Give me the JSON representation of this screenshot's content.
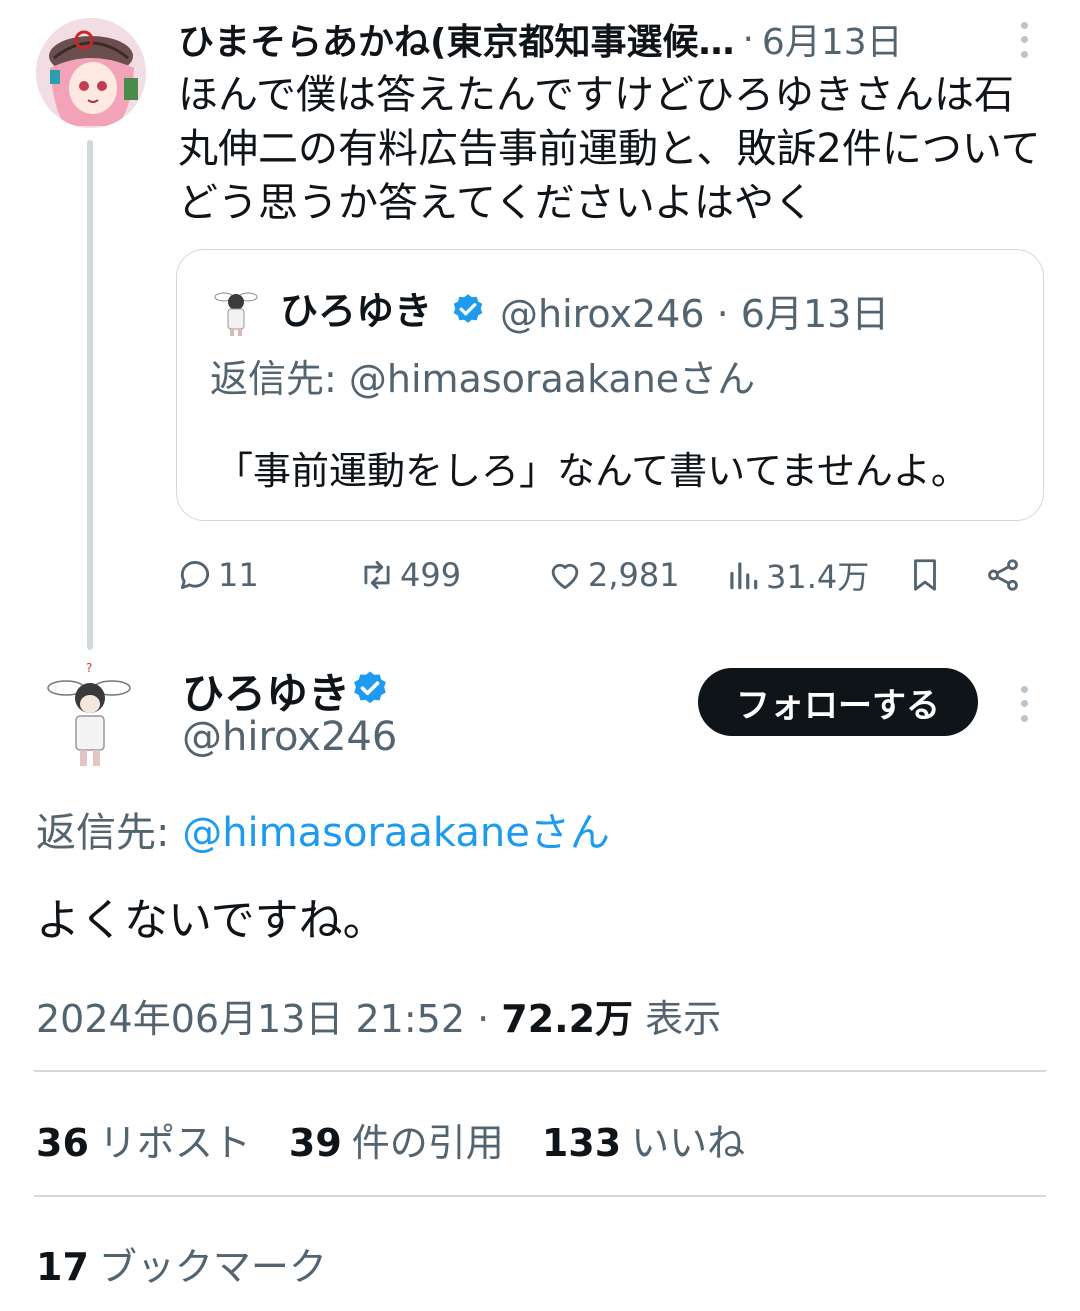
{
  "colors": {
    "text_primary": "#0f1419",
    "text_secondary": "#536471",
    "link": "#1d9bf0",
    "verified": "#1d9bf0",
    "divider": "#cfd9de",
    "follow_button_bg": "#0f1419"
  },
  "parent_post": {
    "display_name": "ひまそらあかね(東京都知事選候…",
    "separator": "·",
    "date": "6月13日",
    "text": "ほんで僕は答えたんですけどひろゆきさんは石\n丸伸二の有料広告事前運動と、敗訴2件について\nどう思うか答えてくださいよはやく",
    "more_icon": "more-vertical-icon",
    "quoted": {
      "display_name": "ひろゆき",
      "verified_icon": "verified-badge-icon",
      "meta": "@hirox246 · 6月13日",
      "reply_to": "返信先: @himasoraakaneさん",
      "text": "「事前運動をしろ」なんて書いてませんよ。"
    },
    "actions": {
      "replies": "11",
      "reposts": "499",
      "likes": "2,981",
      "views": "31.4万",
      "icons": [
        "reply-icon",
        "repost-icon",
        "like-icon",
        "views-icon",
        "bookmark-icon",
        "share-icon"
      ]
    }
  },
  "main_post": {
    "display_name": "ひろゆき",
    "verified_icon": "verified-badge-icon",
    "handle": "@hirox246",
    "follow_label": "フォローする",
    "reply_to_label": "返信先:",
    "reply_to_handle": "@himasoraakaneさん",
    "text": "よくないですね。",
    "timestamp": "2024年06月13日 21:52",
    "timestamp_sep": "·",
    "views_count": "72.2万",
    "views_label": "表示",
    "stats": {
      "reposts_count": "36",
      "reposts_label": "リポスト",
      "quotes_count": "39",
      "quotes_label": "件の引用",
      "likes_count": "133",
      "likes_label": "いいね",
      "bookmarks_count": "17",
      "bookmarks_label": "ブックマーク"
    }
  }
}
